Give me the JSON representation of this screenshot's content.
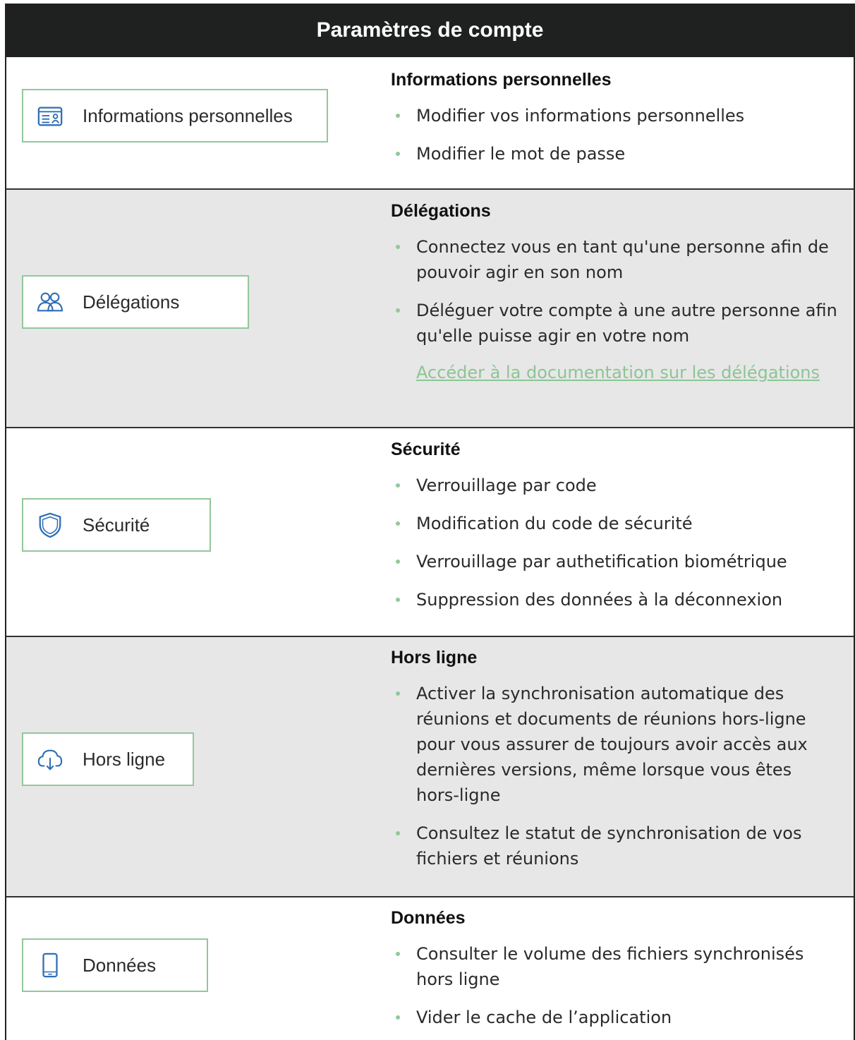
{
  "header": {
    "title": "Paramètres de compte"
  },
  "rows": [
    {
      "button_label": "Informations personnelles",
      "icon": "id-card-icon",
      "heading": "Informations personnelles",
      "items": [
        "Modifier vos informations personnelles",
        "Modifier le mot de passe"
      ]
    },
    {
      "button_label": "Délégations",
      "icon": "users-icon",
      "heading": "Délégations",
      "items": [
        "Connectez vous en tant qu'une personne afin de pouvoir agir en son nom",
        "Déléguer votre compte à une autre personne afin qu'elle puisse agir en votre nom"
      ],
      "link": "Accéder à la documentation sur les délégations"
    },
    {
      "button_label": "Sécurité",
      "icon": "shield-icon",
      "heading": "Sécurité",
      "items": [
        "Verrouillage par code",
        "Modification du code de sécurité",
        "Verrouillage par authetification biométrique",
        "Suppression des données à la déconnexion"
      ]
    },
    {
      "button_label": "Hors ligne",
      "icon": "cloud-download-icon",
      "heading": "Hors ligne",
      "items": [
        "Activer la synchronisation automatique des réunions et documents de réunions hors-ligne pour vous assurer de toujours avoir accès aux dernières versions, même lorsque vous êtes hors-ligne",
        "Consultez le statut de synchronisation de vos fichiers et réunions"
      ]
    },
    {
      "button_label": "Données",
      "icon": "phone-icon",
      "heading": "Données",
      "items": [
        "Consulter le volume des fichiers synchronisés hors ligne",
        "Vider le cache de l’application"
      ]
    }
  ],
  "colors": {
    "header_bg": "#1f2020",
    "accent": "#93c79b",
    "link": "#8cc594",
    "row_alt": "#e7e7e7"
  }
}
